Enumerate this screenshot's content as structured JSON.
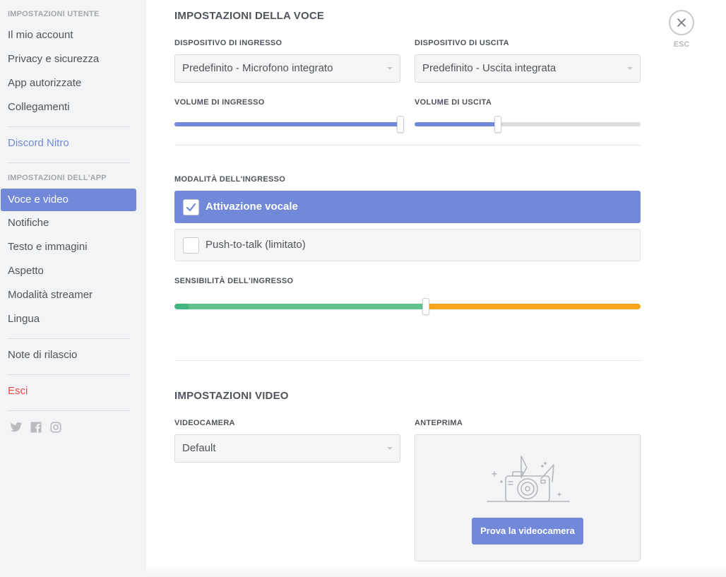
{
  "sidebar": {
    "user_header": "IMPOSTAZIONI UTENTE",
    "user_items": [
      "Il mio account",
      "Privacy e sicurezza",
      "App autorizzate",
      "Collegamenti"
    ],
    "nitro": "Discord Nitro",
    "app_header": "IMPOSTAZIONI DELL'APP",
    "app_items": [
      "Voce e video",
      "Notifiche",
      "Testo e immagini",
      "Aspetto",
      "Modalità streamer",
      "Lingua"
    ],
    "active_item": "Voce e video",
    "release_notes": "Note di rilascio",
    "logout": "Esci",
    "social_icons": [
      "twitter-icon",
      "facebook-icon",
      "instagram-icon"
    ]
  },
  "voice": {
    "title": "IMPOSTAZIONI DELLA VOCE",
    "input_device_label": "DISPOSITIVO DI INGRESSO",
    "input_device_value": "Predefinito - Microfono integrato",
    "output_device_label": "DISPOSITIVO DI USCITA",
    "output_device_value": "Predefinito - Uscita integrata",
    "input_volume_label": "VOLUME DI INGRESSO",
    "input_volume_percent": 100,
    "output_volume_label": "VOLUME DI USCITA",
    "output_volume_percent": 37,
    "input_mode_label": "MODALITÀ DELL'INGRESSO",
    "mode_voice_activity": "Attivazione vocale",
    "mode_push_to_talk": "Push-to-talk (limitato)",
    "selected_mode": "voice_activity",
    "sensitivity_label": "SENSIBILITÀ DELL'INGRESSO",
    "sensitivity_percent": 54
  },
  "video": {
    "title": "IMPOSTAZIONI VIDEO",
    "camera_label": "VIDEOCAMERA",
    "camera_value": "Default",
    "preview_label": "ANTEPRIMA",
    "try_camera_button": "Prova la videocamera"
  },
  "close": {
    "esc_label": "ESC"
  },
  "colors": {
    "accent": "#7289da",
    "danger": "#f04747",
    "sens_low": "#43b581",
    "sens_mid": "#5ec18f",
    "sens_high": "#faa61a"
  }
}
